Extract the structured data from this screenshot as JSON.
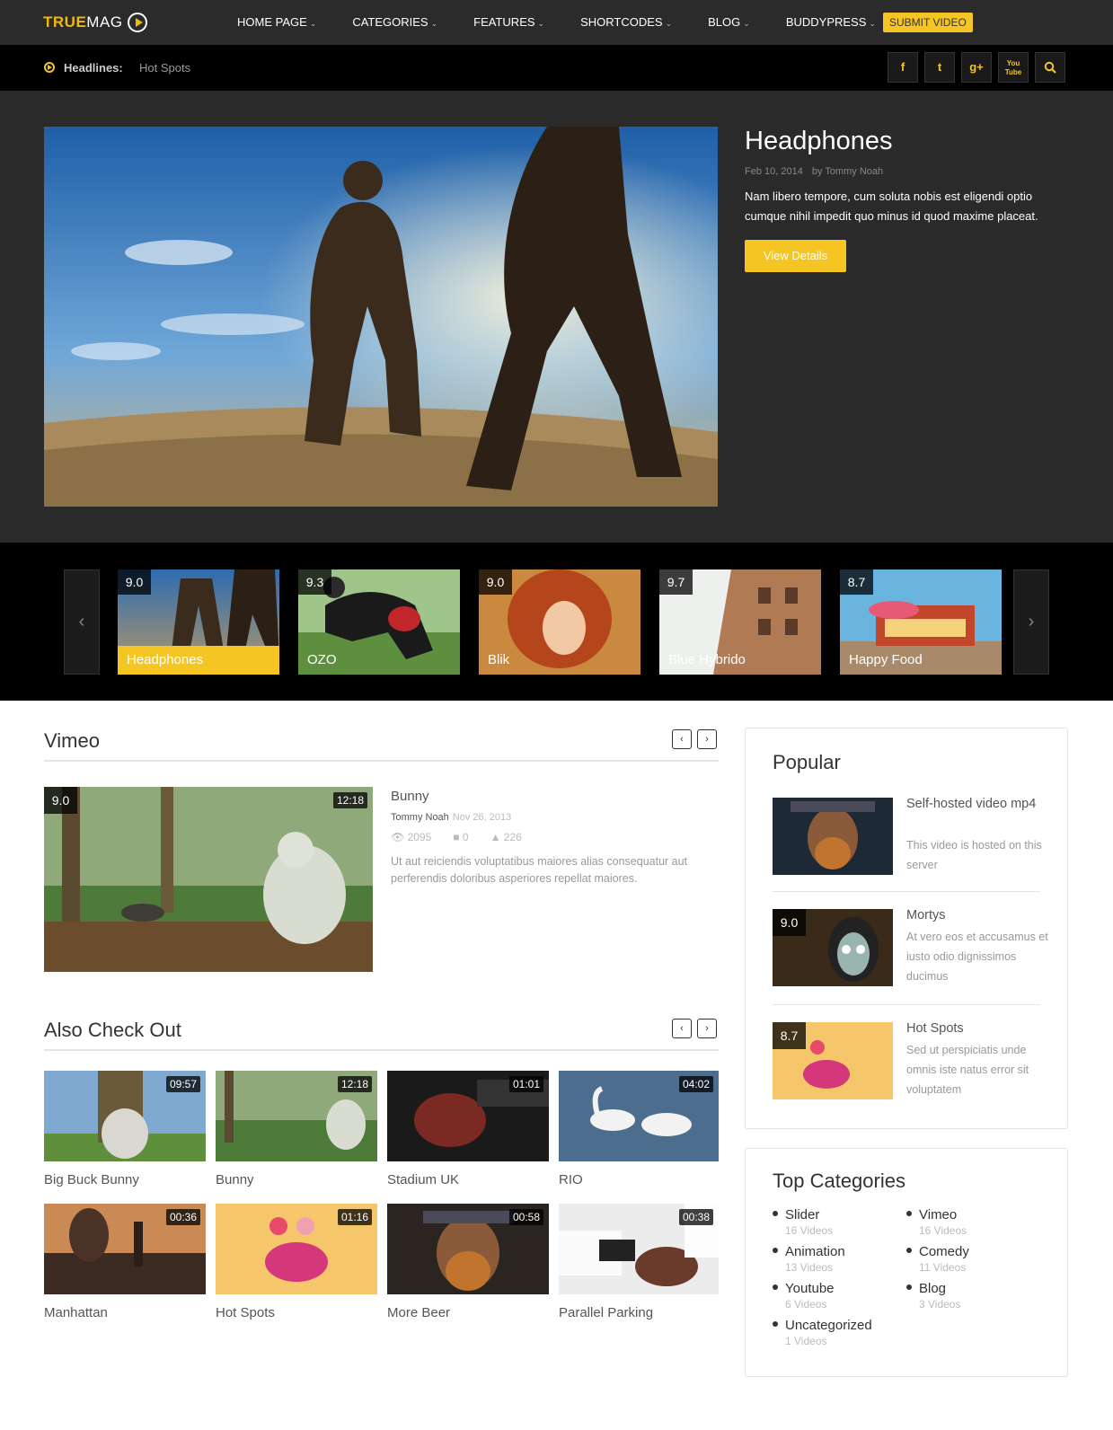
{
  "header": {
    "logo_true": "TRUE",
    "logo_mag": "MAG",
    "menu": [
      {
        "label": "HOME PAGE"
      },
      {
        "label": "CATEGORIES"
      },
      {
        "label": "FEATURES"
      },
      {
        "label": "SHORTCODES"
      },
      {
        "label": "BLOG"
      },
      {
        "label": "BUDDYPRESS"
      }
    ],
    "submit_label": "SUBMIT VIDEO",
    "accent": "#f5c623"
  },
  "headlines": {
    "label": "Headlines:",
    "value": "Hot Spots"
  },
  "social": [
    "f",
    "t",
    "g+",
    "You Tube",
    "search"
  ],
  "hero": {
    "title": "Headphones",
    "date": "Feb 10, 2014",
    "author": "by Tommy Noah",
    "description": "Nam libero tempore, cum soluta nobis est eligendi optio cumque nihil impedit quo minus id quod maxime placeat.",
    "button": "View Details"
  },
  "carousel": [
    {
      "rating": "9.0",
      "title": "Headphones"
    },
    {
      "rating": "9.3",
      "title": "OZO"
    },
    {
      "rating": "9.0",
      "title": "Blik"
    },
    {
      "rating": "9.7",
      "title": "Blue Hybrido"
    },
    {
      "rating": "8.7",
      "title": "Happy Food"
    }
  ],
  "vimeo": {
    "title": "Vimeo",
    "rating": "9.0",
    "duration": "12:18",
    "video_title": "Bunny",
    "author": "Tommy Noah",
    "date": "Nov 26, 2013",
    "views": "2095",
    "comments": "0",
    "likes": "226",
    "description": "Ut aut reiciendis voluptatibus maiores alias consequatur aut perferendis doloribus asperiores repellat maiores."
  },
  "also": {
    "title": "Also Check Out",
    "items": [
      {
        "title": "Big Buck Bunny",
        "duration": "09:57"
      },
      {
        "title": "Bunny",
        "duration": "12:18"
      },
      {
        "title": "Stadium UK",
        "duration": "01:01"
      },
      {
        "title": "RIO",
        "duration": "04:02"
      },
      {
        "title": "Manhattan",
        "duration": "00:36"
      },
      {
        "title": "Hot Spots",
        "duration": "01:16"
      },
      {
        "title": "More Beer",
        "duration": "00:58"
      },
      {
        "title": "Parallel Parking",
        "duration": "00:38"
      }
    ]
  },
  "popular": {
    "title": "Popular",
    "items": [
      {
        "title": "Self-hosted video mp4",
        "desc": "This video is hosted on this server",
        "rating": ""
      },
      {
        "title": "Mortys",
        "desc": "At vero eos et accusamus et iusto odio dignissimos ducimus",
        "rating": "9.0"
      },
      {
        "title": "Hot Spots",
        "desc": "Sed ut perspiciatis unde omnis iste natus error sit voluptatem",
        "rating": "8.7"
      }
    ]
  },
  "categories": {
    "title": "Top Categories",
    "items": [
      {
        "name": "Slider",
        "count": "16 Videos"
      },
      {
        "name": "Vimeo",
        "count": "16 Videos"
      },
      {
        "name": "Animation",
        "count": "13 Videos"
      },
      {
        "name": "Comedy",
        "count": "11 Videos"
      },
      {
        "name": "Youtube",
        "count": "6 Videos"
      },
      {
        "name": "Blog",
        "count": "3 Videos"
      },
      {
        "name": "Uncategorized",
        "count": "1 Videos"
      }
    ]
  }
}
